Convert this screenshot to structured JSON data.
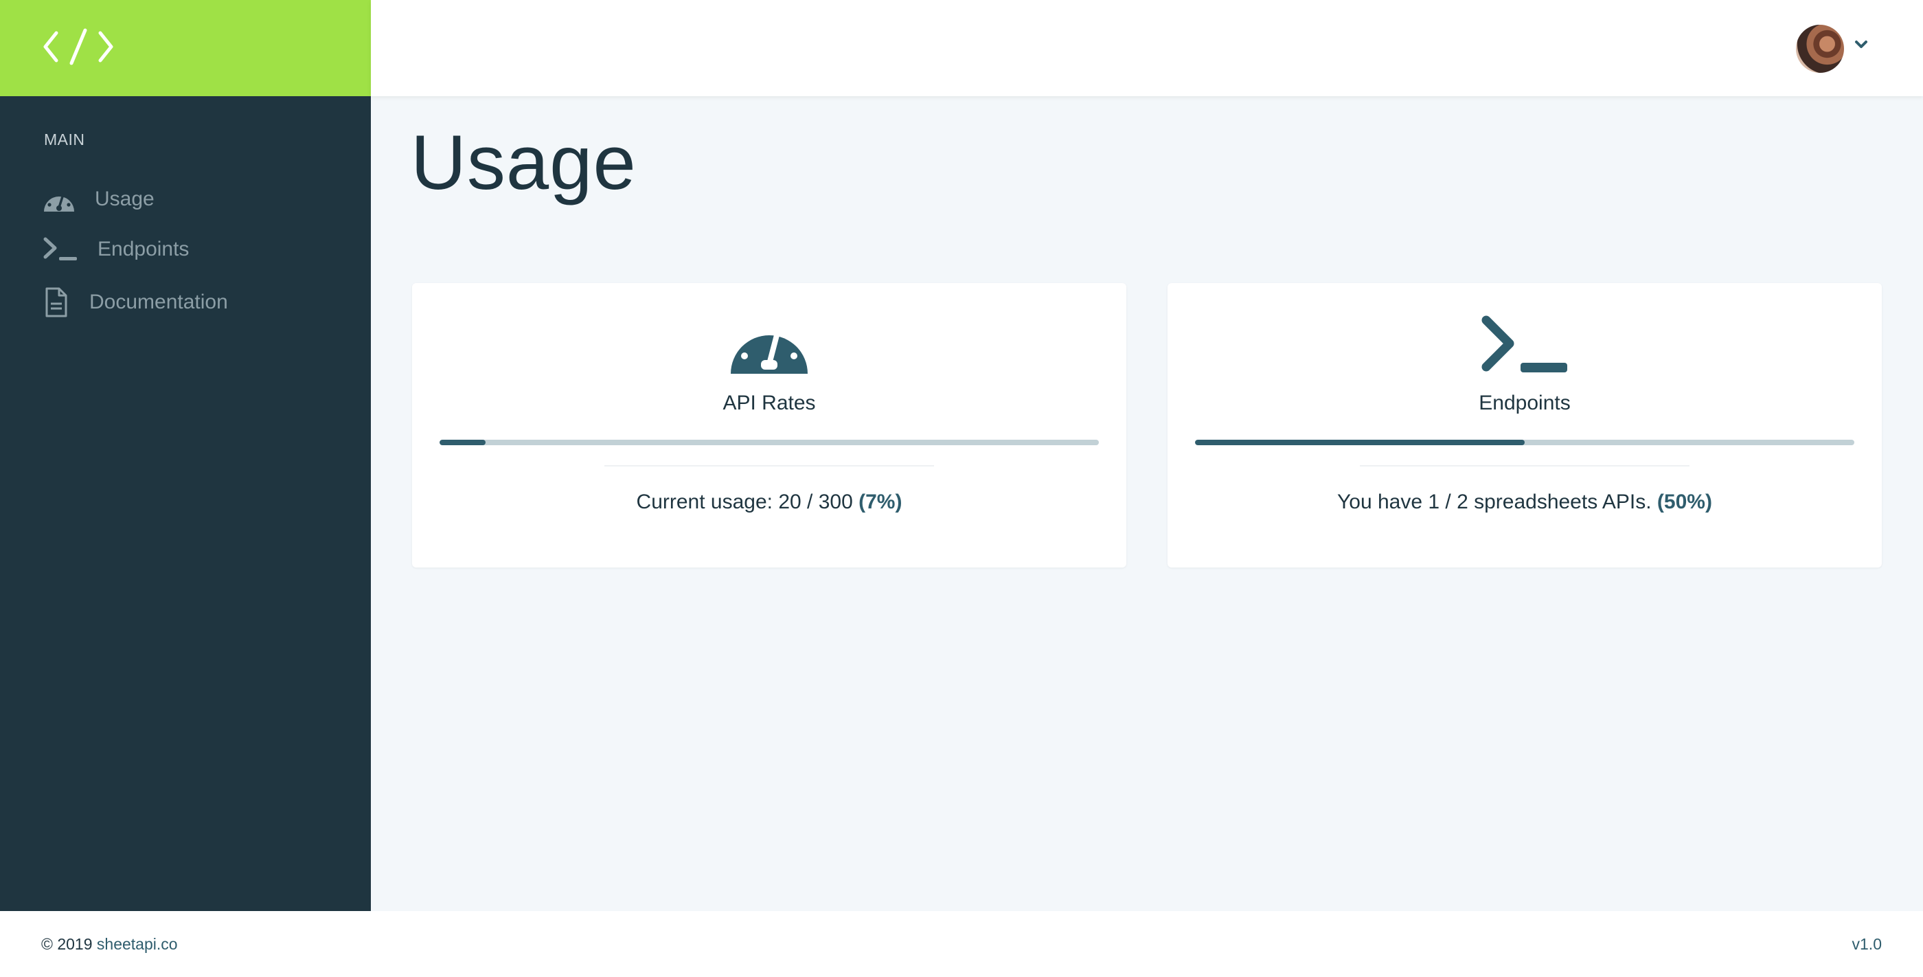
{
  "brand": {
    "logo_icon": "code-icon"
  },
  "sidebar": {
    "heading": "MAIN",
    "items": [
      {
        "label": "Usage",
        "icon": "dashboard-icon"
      },
      {
        "label": "Endpoints",
        "icon": "terminal-icon"
      },
      {
        "label": "Documentation",
        "icon": "document-icon"
      }
    ]
  },
  "header": {
    "avatar_icon": "user-avatar",
    "caret_icon": "chevron-down-icon"
  },
  "main": {
    "title": "Usage",
    "cards": [
      {
        "title": "API Rates",
        "icon": "dashboard-icon",
        "progress": 0.07,
        "stat_text": "Current usage: 20 / 300",
        "stat_pct": "(7%)"
      },
      {
        "title": "Endpoints",
        "icon": "terminal-icon",
        "progress": 0.5,
        "stat_text": "You have 1 / 2 spreadsheets APIs.",
        "stat_pct": "(50%)"
      }
    ]
  },
  "footer": {
    "copyright": "© 2019",
    "link": "sheetapi.co",
    "version": "v1.0"
  },
  "colors": {
    "brand_green": "#9fe146",
    "sidebar_bg": "#1f3540",
    "accent": "#2f5d6d",
    "track": "#c2d1d6",
    "page_bg": "#f3f7fa"
  }
}
